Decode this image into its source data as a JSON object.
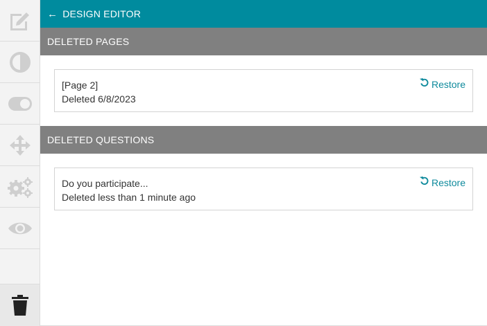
{
  "header": {
    "back_label": "DESIGN EDITOR",
    "accent_color": "#008b9e"
  },
  "sidebar": {
    "items": [
      {
        "name": "edit-icon"
      },
      {
        "name": "contrast-icon"
      },
      {
        "name": "toggle-icon"
      },
      {
        "name": "move-icon"
      },
      {
        "name": "settings-icon"
      },
      {
        "name": "eye-icon"
      },
      {
        "name": "trash-icon",
        "active": true
      }
    ]
  },
  "deleted_pages": {
    "title": "DELETED PAGES",
    "items": [
      {
        "name": "[Page 2]",
        "deleted": "Deleted 6/8/2023",
        "restore_label": "Restore"
      }
    ]
  },
  "deleted_questions": {
    "title": "DELETED QUESTIONS",
    "items": [
      {
        "name": "Do you participate...",
        "deleted": "Deleted less than 1 minute ago",
        "restore_label": "Restore"
      }
    ]
  }
}
